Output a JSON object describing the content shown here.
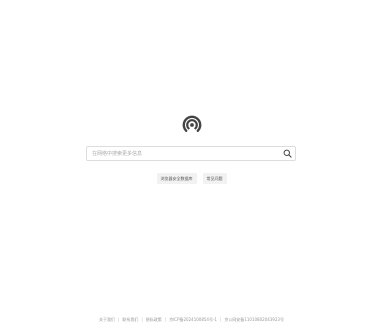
{
  "logo": {
    "icon": "target-spiral-logo",
    "color": "#444444"
  },
  "search": {
    "placeholder": "在网络中搜索更多信息",
    "value": "",
    "button_icon": "search-icon"
  },
  "buttons": [
    {
      "label": "浏览器安全数据库"
    },
    {
      "label": "常见问题"
    }
  ],
  "footer": {
    "items": [
      "关于我们",
      "联系我们",
      "隐私政策",
      "京ICP备2024100854号-1",
      "京公网安备11010802043923号"
    ]
  }
}
